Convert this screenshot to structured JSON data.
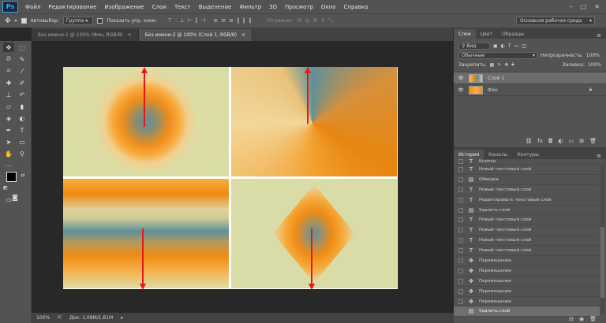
{
  "app": {
    "logo": "Ps"
  },
  "menu": [
    "Файл",
    "Редактирование",
    "Изображение",
    "Слои",
    "Текст",
    "Выделение",
    "Фильтр",
    "3D",
    "Просмотр",
    "Окно",
    "Справка"
  ],
  "window_controls": [
    "–",
    "□",
    "✕"
  ],
  "options": {
    "autoselect_label": "Автовыбор:",
    "autoselect_value": "Группа",
    "show_controls_label": "Показать упр. элем.",
    "mode_3d_label": "3D-режим:",
    "workspace": "Основная рабочая среда"
  },
  "tabs": [
    {
      "label": "Без имени-1 @ 100% (Фон, RGB/8)",
      "close": "×"
    },
    {
      "label": "Без имени-2 @ 100% (Слой 1, RGB/8)",
      "close": "×"
    }
  ],
  "colors": {
    "arrow": "#e8151b",
    "panel_bg": "#535353",
    "app_bg": "#282828"
  },
  "layers_panel": {
    "tabs": [
      "Слои",
      "Цвет",
      "Образцы"
    ],
    "filter_value": "Вид",
    "blend_mode": "Обычные",
    "opacity_label": "Непрозрачность:",
    "opacity_value": "100%",
    "lock_label": "Закрепить:",
    "fill_label": "Заливка:",
    "fill_value": "100%",
    "layers": [
      {
        "name": "Слой 1",
        "selected": true
      },
      {
        "name": "Фон",
        "selected": false
      }
    ],
    "footer_icons": [
      "link-icon",
      "fx-icon",
      "mask-icon",
      "adjustment-icon",
      "folder-icon",
      "new-layer-icon",
      "trash-icon"
    ]
  },
  "history_panel": {
    "tabs": [
      "История",
      "Каналы",
      "Контуры"
    ],
    "items": [
      {
        "label": "Кнопка",
        "icon": "T"
      },
      {
        "label": "Новый текстовый слой",
        "icon": "T"
      },
      {
        "label": "Обводка",
        "icon": "▤"
      },
      {
        "label": "Новый текстовый слой",
        "icon": "T"
      },
      {
        "label": "Редактировать текстовый слой",
        "icon": "T"
      },
      {
        "label": "Удалить слой",
        "icon": "▤"
      },
      {
        "label": "Новый текстовый слой",
        "icon": "T"
      },
      {
        "label": "Новый текстовый слой",
        "icon": "T"
      },
      {
        "label": "Новый текстовый слой",
        "icon": "T"
      },
      {
        "label": "Новый текстовый слой",
        "icon": "T"
      },
      {
        "label": "Перемещение",
        "icon": "✥"
      },
      {
        "label": "Перемещение",
        "icon": "✥"
      },
      {
        "label": "Перемещение",
        "icon": "✥"
      },
      {
        "label": "Перемещение",
        "icon": "✥"
      },
      {
        "label": "Перемещение",
        "icon": "✥"
      },
      {
        "label": "Удалить слой",
        "icon": "▤",
        "active": true
      }
    ]
  },
  "status": {
    "zoom": "100%",
    "doc_info": "Док: 1,08M/1,81M"
  }
}
